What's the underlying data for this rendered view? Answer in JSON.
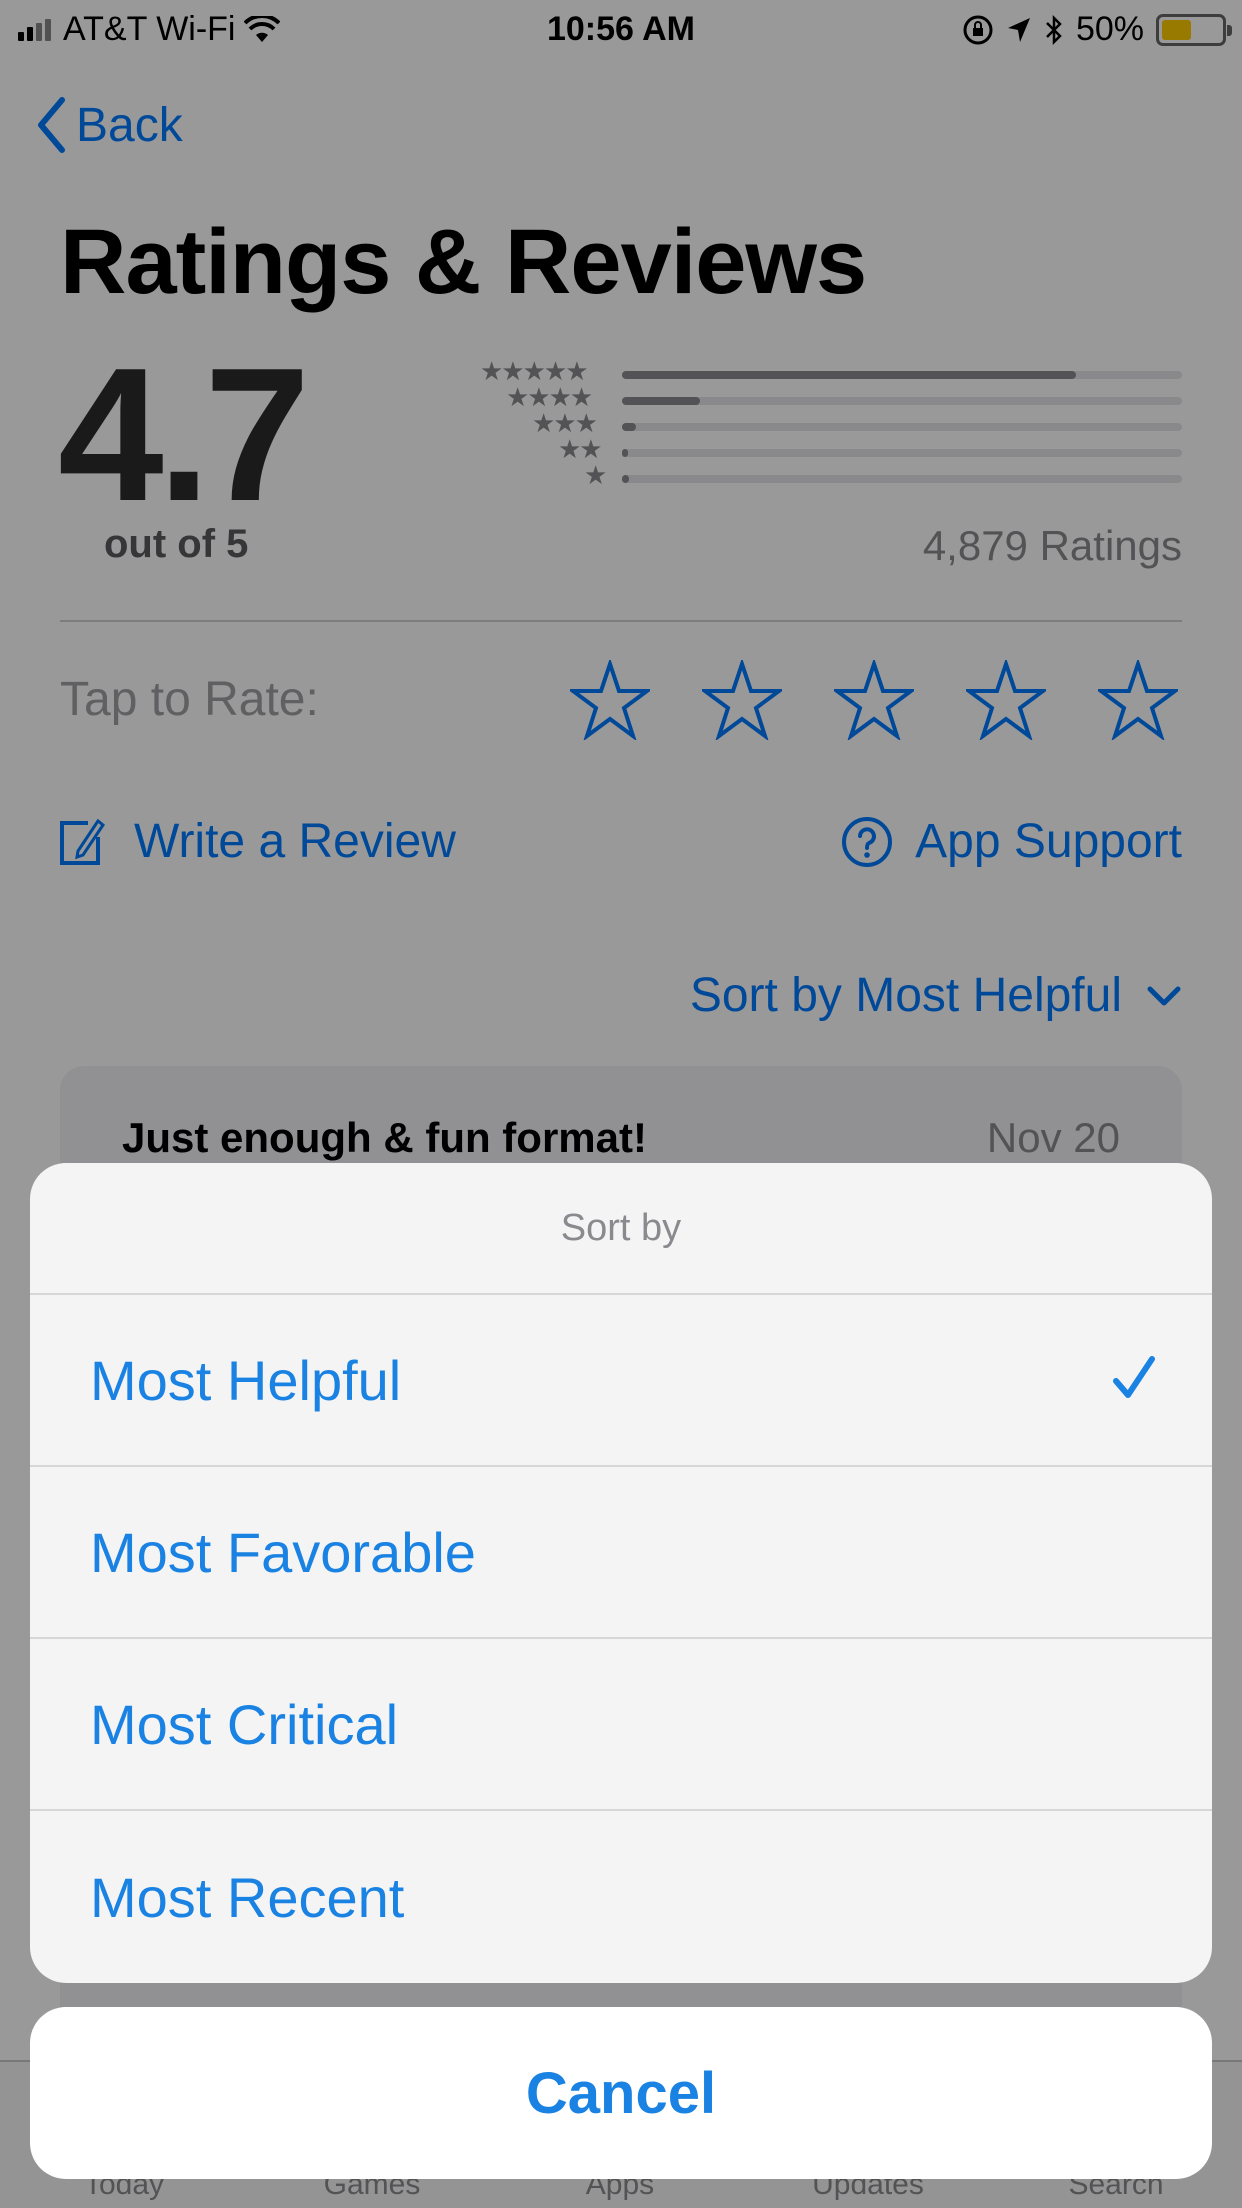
{
  "status_bar": {
    "carrier": "AT&T Wi-Fi",
    "time": "10:56 AM",
    "battery_percent_label": "50%",
    "battery_level": 0.5,
    "signal_bars_active": 2,
    "signal_bars_total": 4,
    "icons": [
      "signal-icon",
      "wifi-icon",
      "rotation-lock-icon",
      "location-icon",
      "bluetooth-icon",
      "battery-icon"
    ]
  },
  "nav": {
    "back_label": "Back"
  },
  "page_title": "Ratings & Reviews",
  "summary": {
    "average": "4.7",
    "out_of": "out of 5",
    "ratings_count": "4,879 Ratings",
    "histogram": [
      {
        "stars": 5,
        "stars_label": "★★★★★",
        "fraction": 0.81
      },
      {
        "stars": 4,
        "stars_label": "★★★★",
        "fraction": 0.14
      },
      {
        "stars": 3,
        "stars_label": "★★★",
        "fraction": 0.025
      },
      {
        "stars": 2,
        "stars_label": "★★",
        "fraction": 0.005
      },
      {
        "stars": 1,
        "stars_label": "★",
        "fraction": 0.012
      }
    ]
  },
  "tap_to_rate": {
    "label": "Tap to Rate:",
    "star_count": 5,
    "selected": 0
  },
  "actions": {
    "write_review": "Write a Review",
    "app_support": "App Support"
  },
  "sort": {
    "current_label": "Sort by Most Helpful"
  },
  "review": {
    "title": "Just enough & fun format!",
    "date": "Nov 20"
  },
  "tab_bar": {
    "items": [
      {
        "label": "Today"
      },
      {
        "label": "Games"
      },
      {
        "label": "Apps"
      },
      {
        "label": "Updates"
      },
      {
        "label": "Search"
      }
    ]
  },
  "action_sheet": {
    "title": "Sort by",
    "options": [
      {
        "label": "Most Helpful",
        "selected": true
      },
      {
        "label": "Most Favorable",
        "selected": false
      },
      {
        "label": "Most Critical",
        "selected": false
      },
      {
        "label": "Most Recent",
        "selected": false
      }
    ],
    "cancel_label": "Cancel"
  },
  "colors": {
    "accent": "#1a82e2",
    "battery": "#ffcc00",
    "overlay": "rgba(0,0,0,0.40)"
  }
}
